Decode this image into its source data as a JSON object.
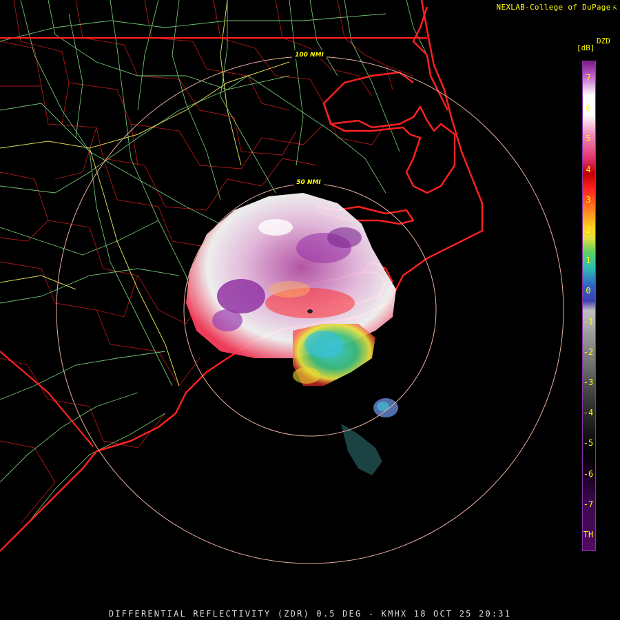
{
  "credit": {
    "text": "NEXLAB-College of DuPage",
    "icon": "arrow-pointer-icon"
  },
  "footer": {
    "text": "DIFFERENTIAL REFLECTIVITY (ZDR) 0.5 DEG - KMHX 18 OCT 25 20:31"
  },
  "range_rings": {
    "inner_label": "50 NMI",
    "outer_label": "100 NMI"
  },
  "colorbar": {
    "product": "DZD",
    "unit": "[dB]",
    "ticks": [
      "7",
      "6",
      "5",
      "4",
      "3",
      "2",
      "1",
      "0",
      "-1",
      "-2",
      "-3",
      "-4",
      "-5",
      "-6",
      "-7",
      "TH"
    ]
  },
  "colors": {
    "state_lines": "#ff2020",
    "county_lines": "#b01818",
    "highways": "#7fd87f",
    "interstates": "#ffff66",
    "range_ring": "#e8b0a0",
    "text_yellow": "#ffff00"
  }
}
